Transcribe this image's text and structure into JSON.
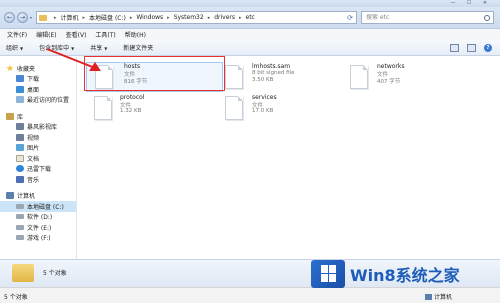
{
  "window": {
    "minimize": "—",
    "maximize": "☐",
    "close": "✕"
  },
  "address_bar": {
    "back": "←",
    "forward": "→",
    "crumbs": [
      "计算机",
      "本地磁盘 (C:)",
      "Windows",
      "System32",
      "drivers",
      "etc"
    ],
    "separator": "▸",
    "refresh": "⟳"
  },
  "search": {
    "placeholder": "搜索 etc"
  },
  "menu": {
    "items": [
      "文件(F)",
      "编辑(E)",
      "查看(V)",
      "工具(T)",
      "帮助(H)"
    ]
  },
  "toolbar": {
    "organize": "组织",
    "include_in_library": "包含到库中",
    "share": "共享",
    "new_folder": "新建文件夹",
    "help": "?"
  },
  "sidebar": {
    "favorites": {
      "label": "收藏夹",
      "items": [
        "下载",
        "桌面",
        "最近访问的位置"
      ]
    },
    "libraries": {
      "label": "库",
      "items": [
        "暴风影视库",
        "视频",
        "图片",
        "文档",
        "迅雷下载",
        "音乐"
      ]
    },
    "computer": {
      "label": "计算机",
      "items": [
        "本地磁盘 (C:)",
        "软件 (D:)",
        "文件 (E:)",
        "游戏 (F:)"
      ]
    },
    "selected": "本地磁盘 (C:)"
  },
  "files": [
    {
      "name": "hosts",
      "type": "文件",
      "size": "816 字节"
    },
    {
      "name": "lmhosts.sam",
      "type": "8 bit signed file",
      "size": "3.50 KB"
    },
    {
      "name": "networks",
      "type": "文件",
      "size": "407 字节"
    },
    {
      "name": "protocol",
      "type": "文件",
      "size": "1.32 KB"
    },
    {
      "name": "services",
      "type": "文件",
      "size": "17.0 KB"
    }
  ],
  "status": {
    "count": "5 个对象",
    "bottom_left": "5 个对象",
    "bottom_right": "计算机"
  },
  "watermark": {
    "text": "Win8系统之家"
  },
  "colors": {
    "highlight": "#e53333",
    "selected": "#cce4f7",
    "accent": "#1d5cb8"
  }
}
